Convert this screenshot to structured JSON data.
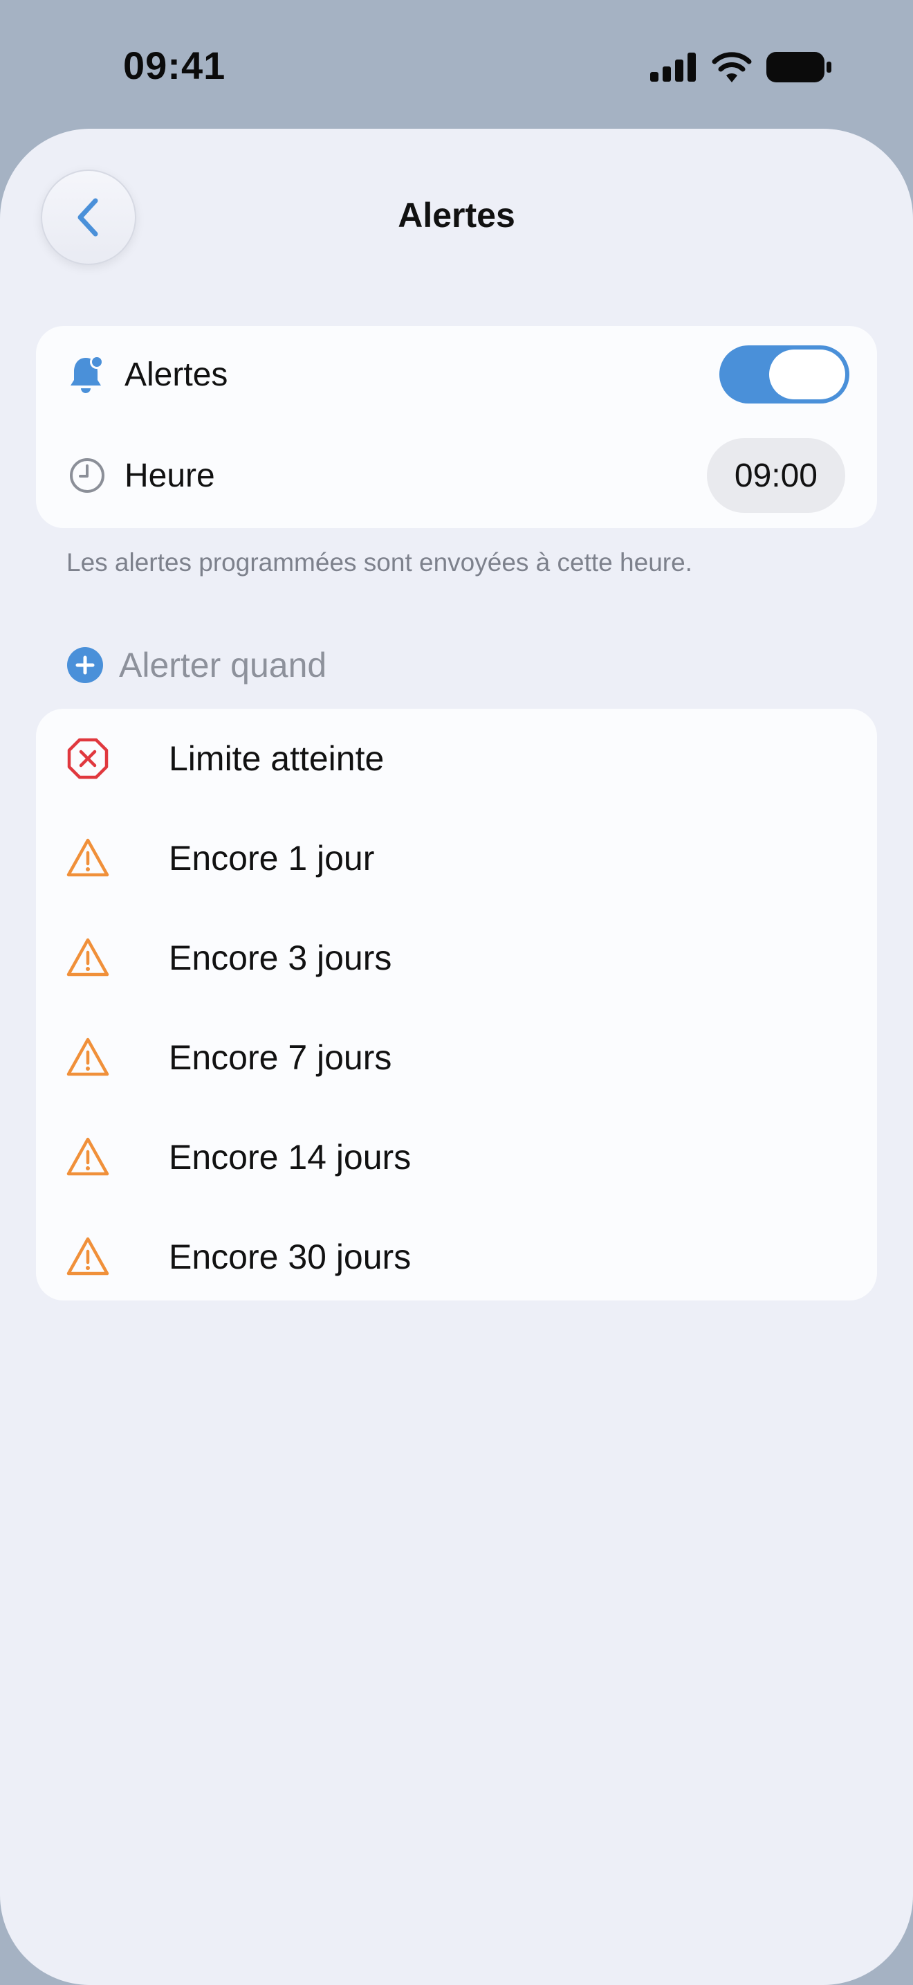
{
  "status_bar": {
    "time": "09:41",
    "icons": [
      "cellular-signal-icon",
      "wifi-icon",
      "battery-icon"
    ]
  },
  "header": {
    "title": "Alertes",
    "back_icon": "chevron-left-icon"
  },
  "settings": {
    "alerts_label": "Alertes",
    "alerts_enabled": true,
    "time_label": "Heure",
    "time_value": "09:00",
    "footnote": "Les alertes programmées sont envoyées à cette heure."
  },
  "alert_when": {
    "header": "Alerter quand",
    "items": [
      {
        "label": "Limite atteinte",
        "icon": "x-octagon-icon",
        "color": "#e0383e"
      },
      {
        "label": "Encore 1 jour",
        "icon": "warning-triangle-icon",
        "color": "#f0903a"
      },
      {
        "label": "Encore 3 jours",
        "icon": "warning-triangle-icon",
        "color": "#f0903a"
      },
      {
        "label": "Encore 7 jours",
        "icon": "warning-triangle-icon",
        "color": "#f0903a"
      },
      {
        "label": "Encore 14 jours",
        "icon": "warning-triangle-icon",
        "color": "#f0903a"
      },
      {
        "label": "Encore 30 jours",
        "icon": "warning-triangle-icon",
        "color": "#f0903a"
      }
    ]
  },
  "colors": {
    "accent": "#4a90d9",
    "warning": "#f0903a",
    "error": "#e0383e",
    "background": "#edeff7"
  }
}
